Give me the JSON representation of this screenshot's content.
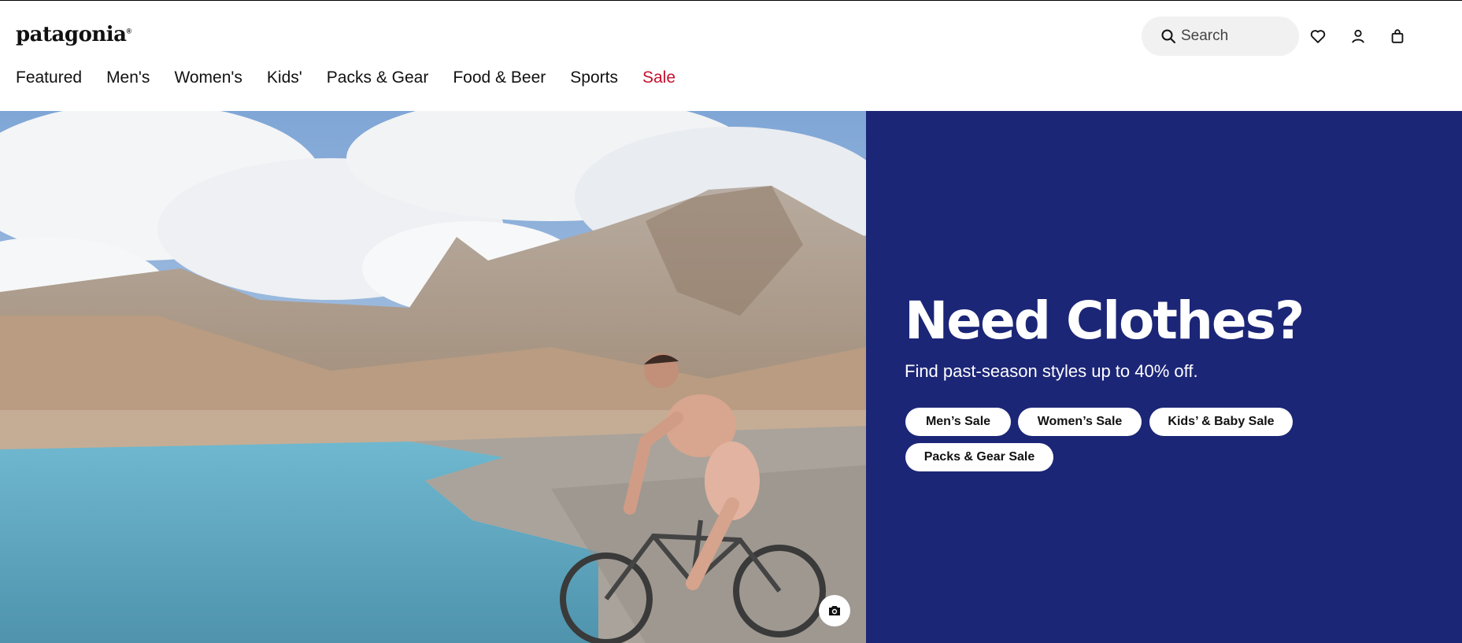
{
  "header": {
    "logo": "patagonia",
    "search": {
      "placeholder": "Search"
    },
    "icons": [
      "heart-icon",
      "account-icon",
      "bag-icon"
    ]
  },
  "nav": {
    "items": [
      {
        "label": "Featured"
      },
      {
        "label": "Men's"
      },
      {
        "label": "Women's"
      },
      {
        "label": "Kids'"
      },
      {
        "label": "Packs & Gear"
      },
      {
        "label": "Food & Beer"
      },
      {
        "label": "Sports"
      },
      {
        "label": "Sale"
      }
    ]
  },
  "hero": {
    "title": "Need Clothes?",
    "subtitle": "Find past-season styles up to 40% off.",
    "buttons": [
      {
        "label": "Men’s Sale"
      },
      {
        "label": "Women’s Sale"
      },
      {
        "label": "Kids’ & Baby Sale"
      },
      {
        "label": "Packs & Gear Sale"
      }
    ],
    "photo_icon": "camera-icon"
  },
  "colors": {
    "promo_bg": "#1c2677",
    "sale_red": "#c8102e",
    "search_bg": "#f1f1f1"
  }
}
